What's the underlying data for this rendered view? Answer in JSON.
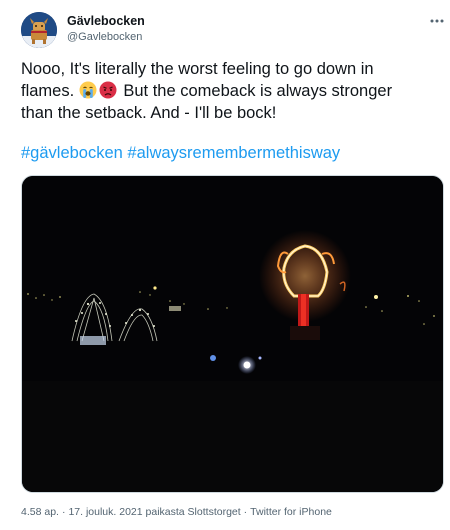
{
  "user": {
    "display_name": "Gävlebocken",
    "handle": "@Gavlebocken"
  },
  "more_icon": "more-horizontal-icon",
  "tweet": {
    "line1": "Nooo, It's literally the worst feeling to go down in",
    "line2_before": "flames.",
    "line2_after": " But the comeback is always stronger",
    "line3": "than the setback. And - I'll be bock!",
    "emojis": [
      "loudly-crying-face-emoji",
      "pouting-face-emoji"
    ],
    "hashtags": [
      "#gävlebocken",
      "#alwaysremembermethisway"
    ]
  },
  "media": {
    "icon": "night-photo-of-burning-goat"
  },
  "meta": {
    "time": "4.58 ap.",
    "date": "17. jouluk. 2021",
    "location": "paikasta Slottstorget",
    "source": "Twitter for iPhone",
    "separator": "·"
  },
  "colors": {
    "link": "#1d9bf0",
    "text": "#0f1419",
    "secondary": "#536471"
  }
}
